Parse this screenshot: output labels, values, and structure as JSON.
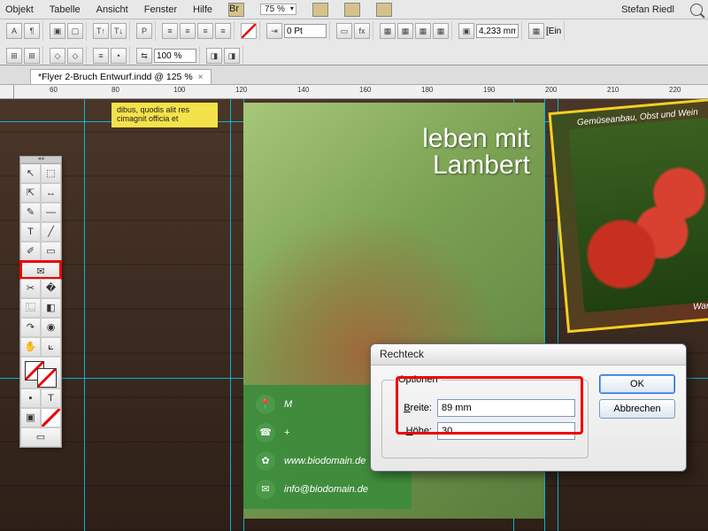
{
  "menu": {
    "items": [
      "Objekt",
      "Tabelle",
      "Ansicht",
      "Fenster",
      "Hilfe"
    ],
    "zoom": "75 %",
    "user": "Stefan Riedl",
    "ein": "[Ein"
  },
  "ctrl": {
    "pt": "0 Pt",
    "pct": "100 %",
    "mm": "4,233 mm"
  },
  "doc": {
    "name": "*Flyer 2-Bruch Entwurf.indd @ 125 %",
    "ruler_marks": [
      60,
      80,
      100,
      120,
      140,
      160,
      180,
      190,
      200,
      210,
      220
    ]
  },
  "note": {
    "text": "dibus, quodis alit res cimagnit officia et"
  },
  "hero": {
    "line1": "leben mit",
    "line2": "Lambert"
  },
  "veggie": {
    "caption_top": "Gemüseanbau, Obst und Wein",
    "caption_bottom": "Waren au"
  },
  "contact": {
    "rows": [
      {
        "icon": "📍",
        "text": "M"
      },
      {
        "icon": "☎",
        "text": "+"
      },
      {
        "icon": "✿",
        "text": "www.biodomain.de"
      },
      {
        "icon": "✉",
        "text": "info@biodomain.de"
      }
    ]
  },
  "dialog": {
    "title": "Rechteck",
    "legend": "Optionen",
    "breite_label": "Breite:",
    "breite_value": "89 mm",
    "hoehe_label": "Höhe:",
    "hoehe_value": "30",
    "ok": "OK",
    "cancel": "Abbrechen"
  },
  "tools": {
    "rows": [
      [
        "↖",
        "⬚"
      ],
      [
        "⇱",
        "↔"
      ],
      [
        "✎",
        "—"
      ],
      [
        "T",
        "╱"
      ],
      [
        "✐",
        "▭"
      ],
      [
        "✉",
        ""
      ],
      [
        "✂",
        "�⿻"
      ],
      [
        "⿺",
        "◧"
      ],
      [
        "↷",
        "◉"
      ],
      [
        "✋",
        "⟀"
      ],
      [
        "Q",
        "⊞"
      ]
    ]
  }
}
